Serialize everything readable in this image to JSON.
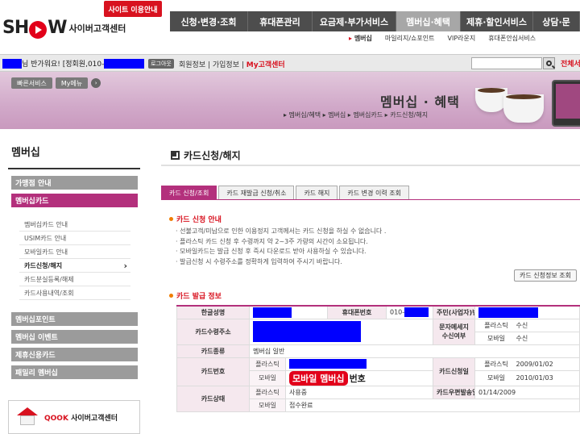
{
  "header": {
    "logo_text": "SHOW",
    "logo_sub": "사이버고객센터",
    "site_guide": "사이트 이용안내",
    "gnb": [
      {
        "label": "신청·변경·조회"
      },
      {
        "label": "휴대폰관리"
      },
      {
        "label": "요금제·부가서비스"
      },
      {
        "label": "멤버십·혜택"
      },
      {
        "label": "제휴·할인서비스"
      },
      {
        "label": "상담·문"
      }
    ],
    "sub_gnb": [
      "멤버십",
      "마일리지/쇼포인트",
      "VIP라운지",
      "휴대폰안심서비스"
    ]
  },
  "userbar": {
    "greet": "님 반가워요! [정회원,010-",
    "logout": "로그아웃",
    "links": "회원정보 | 가입정보 | ",
    "my": "My고객센터",
    "all_menu": "전체서"
  },
  "banner": {
    "quick": [
      "빠른서비스",
      "My메뉴"
    ],
    "quick_arrow": "›",
    "title": "멤버십 · 혜택",
    "path": "▸ 멤버십/혜택 ▸ 멤버십 ▸ 멤버십카드 ▸ 카드신청/해지"
  },
  "sidebar": {
    "title": "멤버십",
    "menu": [
      "가맹점 안내",
      "멤버십카드",
      "멤버십포인트",
      "멤버십 이벤트",
      "제휴신용카드",
      "패밀리 멤버십"
    ],
    "sub": [
      "멤버십카드 안내",
      "USIM카드 안내",
      "모바일카드 안내",
      "카드신청/해지",
      "카드분실등록/해제",
      "카드사용내역/조회"
    ],
    "chev": "›",
    "qook_brand": "QOOK",
    "qook_label": " 사이버고객센터"
  },
  "main": {
    "title": "카드신청/해지",
    "tabs": [
      "카드 신청/조회",
      "카드 재발급 신청/취소",
      "카드 해지",
      "카드 변경 이력 조회"
    ],
    "sec1": "카드 신청 안내",
    "notices": [
      "선불고객/미납으로 인한 이용정지 고객께서는 카드 신청을 하실 수 없습니다 .",
      "플라스틱 카드 신청 후 수령까지 약 2~3주 가량의 시간이 소요됩니다.",
      "모바일카드는 발급 신청 후 즉시 다운로드 받아 사용하실 수 있습니다.",
      "발급신청 시 수령주소를 정확하게 입력하여 주시기 바랍니다."
    ],
    "inquiry_btn": "카드 신청정보 조회",
    "sec2": "카드 발급 정보",
    "table": {
      "name_h": "한글성명",
      "phone_h": "휴대폰번호",
      "phone_prefix": "010-",
      "jumin_h": "주민(사업자)번호",
      "addr_h": "카드수령주소",
      "sms_h": "문자메세지 수신여부",
      "plastic": "플라스틱",
      "mobile": "모바일",
      "receive": "수신",
      "type_h": "카드종류",
      "type_v": "멤버십 일반",
      "cardno_h": "카드번호",
      "mobile_no_label": "모바일 멤버십",
      "mobile_no_suffix": "번호",
      "apply_h": "카드신청일",
      "apply_plastic": "2009/01/02",
      "apply_mobile": "2010/01/03",
      "status_h": "카드상태",
      "status_plastic": "사용중",
      "status_mobile": "접수완료",
      "ship_h": "카드우편발송일",
      "ship_v": "01/14/2009"
    }
  }
}
